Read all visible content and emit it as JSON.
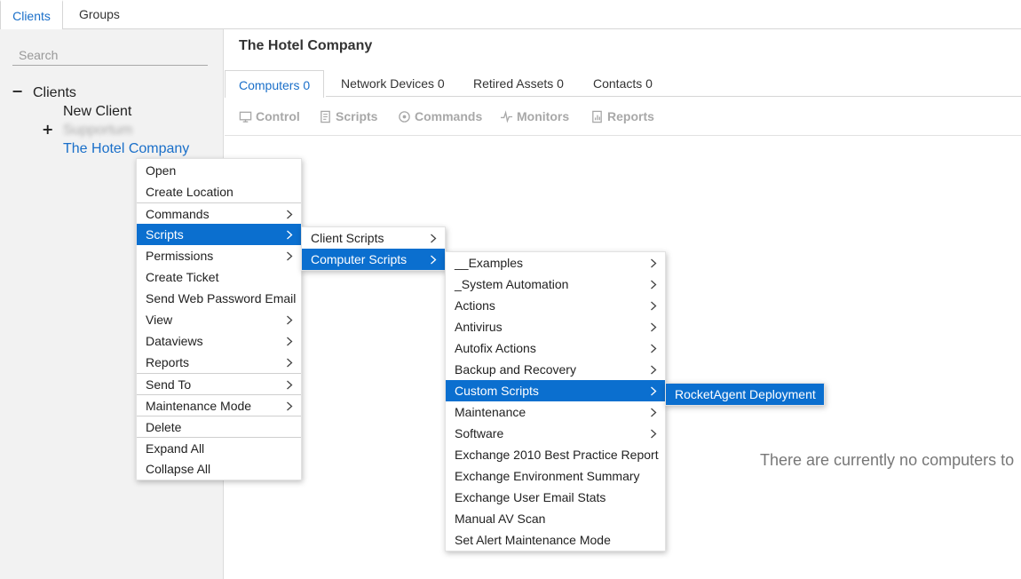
{
  "left_tabs": {
    "clients": "Clients",
    "groups": "Groups"
  },
  "search": {
    "placeholder": "Search"
  },
  "tree": {
    "root_toggle": "−",
    "root_label": "Clients",
    "items": [
      {
        "label": "New Client"
      },
      {
        "toggle": "+",
        "label": "Supportum"
      },
      {
        "label": "The Hotel Company"
      }
    ]
  },
  "header": {
    "title": "The Hotel Company"
  },
  "tabs": [
    {
      "label": "Computers 0"
    },
    {
      "label": "Network Devices 0"
    },
    {
      "label": "Retired Assets 0"
    },
    {
      "label": "Contacts 0"
    }
  ],
  "toolbar": [
    {
      "label": "Control",
      "icon": "monitor-icon"
    },
    {
      "label": "Scripts",
      "icon": "script-icon"
    },
    {
      "label": "Commands",
      "icon": "commands-icon"
    },
    {
      "label": "Monitors",
      "icon": "pulse-icon"
    },
    {
      "label": "Reports",
      "icon": "report-icon"
    }
  ],
  "empty_message": "There are currently no computers to",
  "context_menu": [
    {
      "label": "Open"
    },
    {
      "label": "Create Location"
    },
    {
      "label": "Commands",
      "submenu": true
    },
    {
      "label": "Scripts",
      "submenu": true,
      "highlighted": true
    },
    {
      "label": "Permissions",
      "submenu": true
    },
    {
      "label": "Create Ticket"
    },
    {
      "label": "Send Web Password Email"
    },
    {
      "label": "View",
      "submenu": true
    },
    {
      "label": "Dataviews",
      "submenu": true
    },
    {
      "label": "Reports",
      "submenu": true
    },
    {
      "label": "Send To",
      "submenu": true
    },
    {
      "label": "Maintenance Mode",
      "submenu": true
    },
    {
      "label": "Delete"
    },
    {
      "label": "Expand All"
    },
    {
      "label": "Collapse All"
    }
  ],
  "scripts_menu": [
    {
      "label": "Client Scripts",
      "submenu": true
    },
    {
      "label": "Computer Scripts",
      "submenu": true,
      "highlighted": true
    }
  ],
  "computer_scripts_menu": [
    {
      "label": "__Examples",
      "submenu": true
    },
    {
      "label": "_System Automation",
      "submenu": true
    },
    {
      "label": "Actions",
      "submenu": true
    },
    {
      "label": "Antivirus",
      "submenu": true
    },
    {
      "label": "Autofix Actions",
      "submenu": true
    },
    {
      "label": "Backup and Recovery",
      "submenu": true
    },
    {
      "label": "Custom Scripts",
      "submenu": true,
      "highlighted": true
    },
    {
      "label": "Maintenance",
      "submenu": true
    },
    {
      "label": "Software",
      "submenu": true
    },
    {
      "label": "Exchange 2010 Best Practice Report"
    },
    {
      "label": "Exchange Environment Summary"
    },
    {
      "label": "Exchange User Email Stats"
    },
    {
      "label": "Manual AV Scan"
    },
    {
      "label": "Set Alert Maintenance Mode"
    }
  ],
  "custom_scripts_menu": [
    {
      "label": "RocketAgent Deployment",
      "highlighted": true
    }
  ],
  "colors": {
    "accent": "#1a6fc9",
    "highlight": "#0b6fcf",
    "panel_bg": "#f2f2f2"
  }
}
